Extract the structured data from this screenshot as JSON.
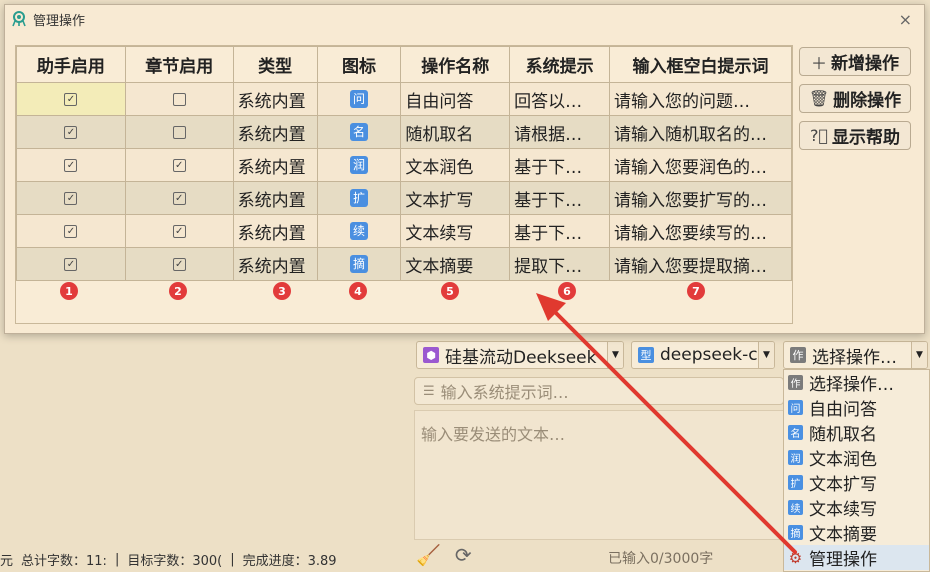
{
  "dialog": {
    "title": "管理操作",
    "close_glyph": "×",
    "columns": [
      "助手启用",
      "章节启用",
      "类型",
      "图标",
      "操作名称",
      "系统提示",
      "输入框空白提示词"
    ],
    "rows": [
      {
        "assistant": true,
        "chapter": false,
        "type": "系统内置",
        "icon": "问",
        "name": "自由问答",
        "prompt": "回答以…",
        "placeholder": "请输入您的问题…"
      },
      {
        "assistant": true,
        "chapter": false,
        "type": "系统内置",
        "icon": "名",
        "name": "随机取名",
        "prompt": "请根据…",
        "placeholder": "请输入随机取名的…"
      },
      {
        "assistant": true,
        "chapter": true,
        "type": "系统内置",
        "icon": "润",
        "name": "文本润色",
        "prompt": "基于下…",
        "placeholder": "请输入您要润色的…"
      },
      {
        "assistant": true,
        "chapter": true,
        "type": "系统内置",
        "icon": "扩",
        "name": "文本扩写",
        "prompt": "基于下…",
        "placeholder": "请输入您要扩写的…"
      },
      {
        "assistant": true,
        "chapter": true,
        "type": "系统内置",
        "icon": "续",
        "name": "文本续写",
        "prompt": "基于下…",
        "placeholder": "请输入您要续写的…"
      },
      {
        "assistant": true,
        "chapter": true,
        "type": "系统内置",
        "icon": "摘",
        "name": "文本摘要",
        "prompt": "提取下…",
        "placeholder": "请输入您要提取摘…"
      }
    ],
    "markers": [
      "1",
      "2",
      "3",
      "4",
      "5",
      "6",
      "7"
    ],
    "buttons": {
      "add": "新增操作",
      "delete": "删除操作",
      "help": "显示帮助"
    }
  },
  "chat": {
    "provider": "硅基流动Deekseek",
    "model": "deepseek-c",
    "operation_select": "选择操作…",
    "system_prompt_placeholder": "输入系统提示词…",
    "message_placeholder": "输入要发送的文本…",
    "input_count": "已输入0/3000字"
  },
  "dropdown": {
    "options": [
      {
        "icon": "作",
        "label": "选择操作…"
      },
      {
        "icon": "问",
        "label": "自由问答"
      },
      {
        "icon": "名",
        "label": "随机取名"
      },
      {
        "icon": "润",
        "label": "文本润色"
      },
      {
        "icon": "扩",
        "label": "文本扩写"
      },
      {
        "icon": "续",
        "label": "文本续写"
      },
      {
        "icon": "摘",
        "label": "文本摘要"
      },
      {
        "icon": "⚙",
        "label": "管理操作"
      }
    ]
  },
  "statusbar": {
    "unit": "元",
    "total_words": "总计字数：11:",
    "target_words": "目标字数：300(",
    "progress": "完成进度：3.89"
  },
  "colors": {
    "accent_blue": "#4a8fe0",
    "marker_red": "#e23b3b",
    "arrow_red": "#e0392f",
    "background": "#ede0c6"
  }
}
